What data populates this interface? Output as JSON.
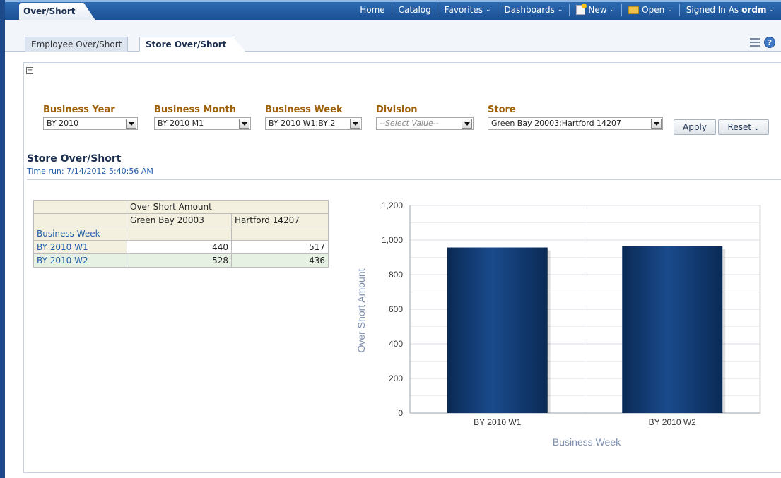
{
  "app": {
    "main_tab": "Over/Short",
    "nav": [
      "Home",
      "Catalog",
      "Favorites",
      "Dashboards",
      "New",
      "Open"
    ],
    "signed_in_label": "Signed In As",
    "user": "ordm"
  },
  "subtabs": {
    "inactive": "Employee Over/Short",
    "active": "Store Over/Short"
  },
  "prompts": [
    {
      "label": "Business Year",
      "value": "BY 2010"
    },
    {
      "label": "Business Month",
      "value": "BY 2010 M1"
    },
    {
      "label": "Business Week",
      "value": "BY 2010 W1;BY 2"
    },
    {
      "label": "Division",
      "value": "--Select Value--"
    },
    {
      "label": "Store",
      "value": "Green Bay 20003;Hartford 14207"
    }
  ],
  "buttons": {
    "apply": "Apply",
    "reset": "Reset"
  },
  "report": {
    "title": "Store Over/Short",
    "time_run": "Time run: 7/14/2012 5:40:56 AM"
  },
  "table": {
    "measure": "Over Short Amount",
    "columns": [
      "Green Bay 20003",
      "Hartford 14207"
    ],
    "row_header": "Business Week",
    "rows": [
      {
        "label": "BY 2010 W1",
        "values": [
          "440",
          "517"
        ]
      },
      {
        "label": "BY 2010 W2",
        "values": [
          "528",
          "436"
        ]
      }
    ]
  },
  "chart_data": {
    "type": "bar",
    "categories": [
      "BY 2010 W1",
      "BY 2010 W2"
    ],
    "values": [
      957,
      964
    ],
    "xlabel": "Business Week",
    "ylabel": "Over Short Amount",
    "ylim": [
      0,
      1200
    ],
    "yticks": [
      0,
      200,
      400,
      600,
      800,
      1000,
      1200
    ],
    "ytick_labels": [
      "0",
      "200",
      "400",
      "600",
      "800",
      "1,000",
      "1,200"
    ],
    "grid": true,
    "bar_color": "#0e3366"
  }
}
